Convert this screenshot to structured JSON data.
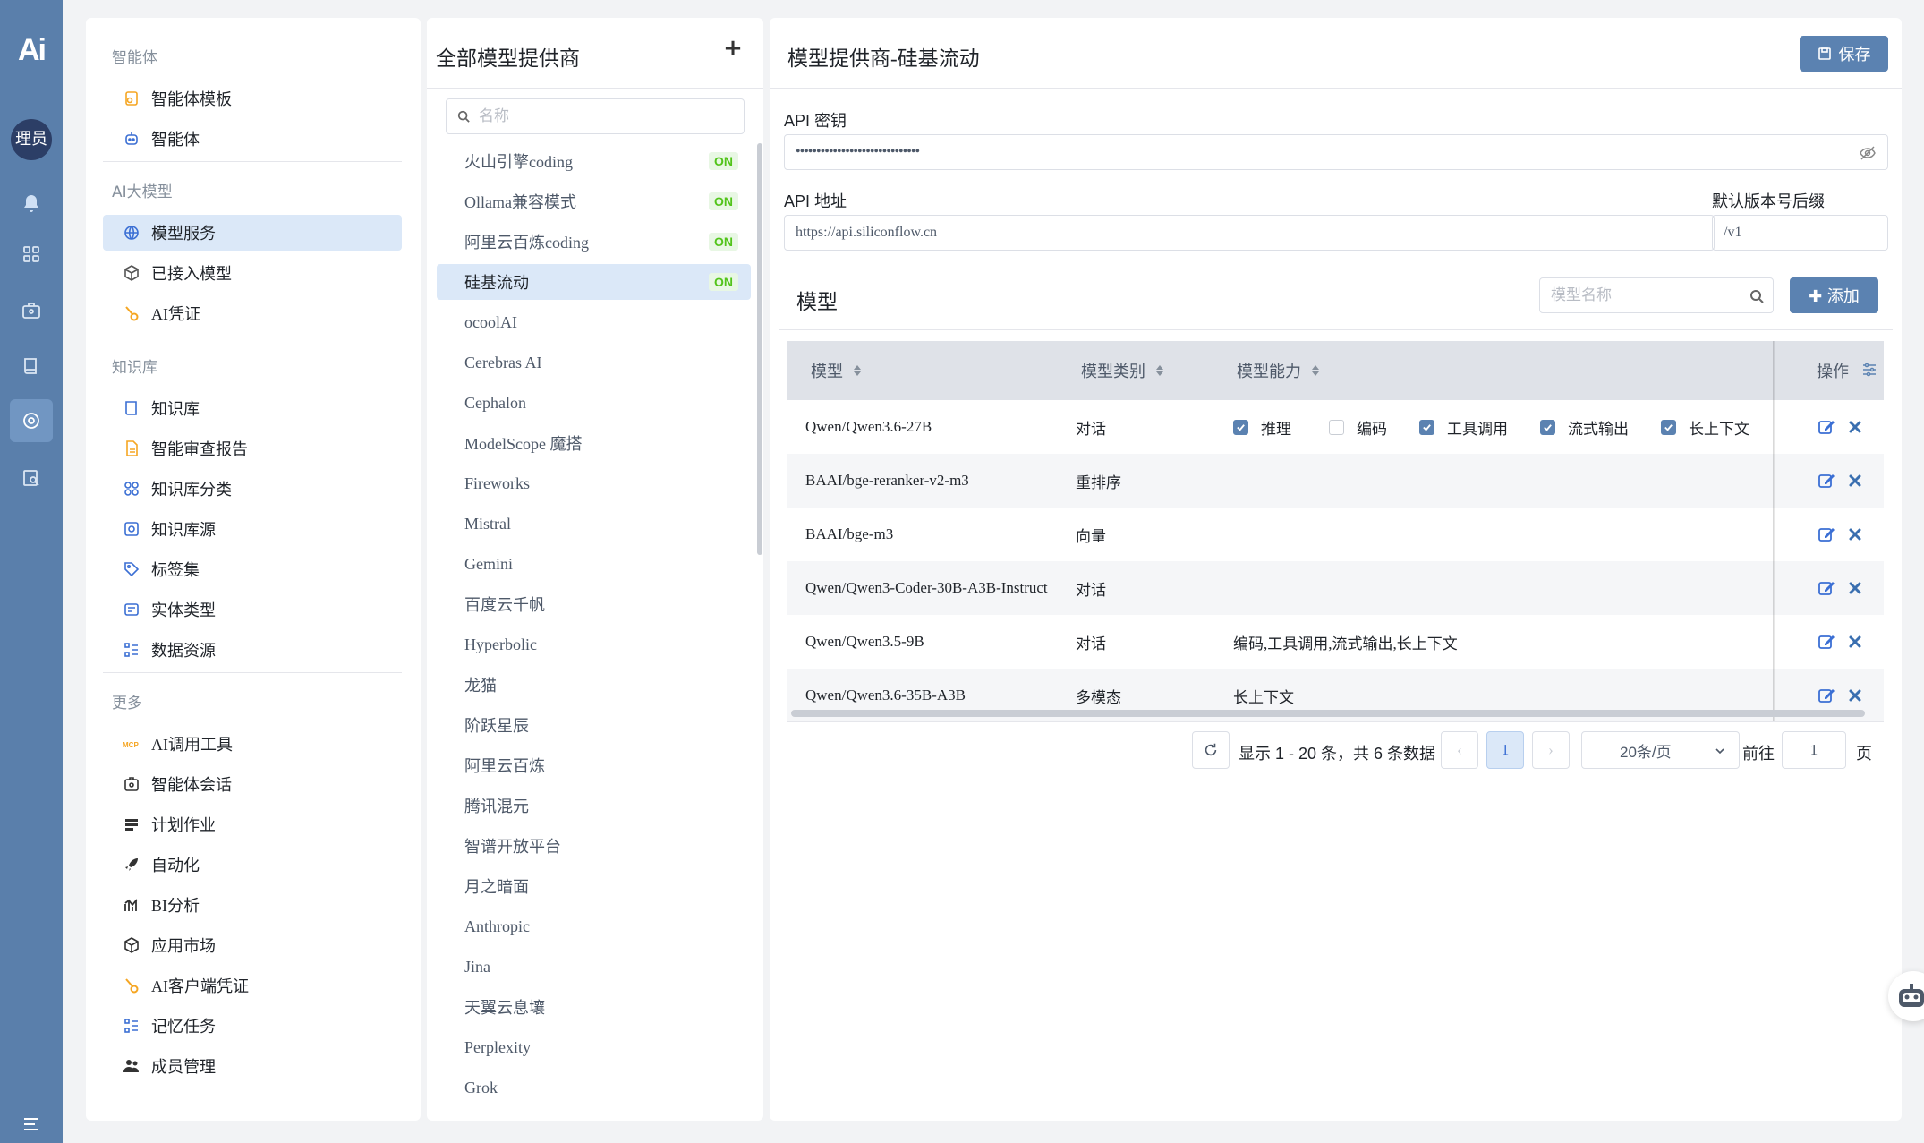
{
  "rail": {
    "logo": "Ai",
    "avatar": "理员",
    "icons": [
      "bell-icon",
      "grid-icon",
      "briefcase-icon",
      "book-icon",
      "model-icon",
      "search-doc-icon",
      "menu-icon"
    ]
  },
  "menu": {
    "groups": [
      {
        "label": "智能体",
        "items": [
          {
            "label": "智能体模板",
            "icon": "template-icon",
            "color": "#f5a623"
          },
          {
            "label": "智能体",
            "icon": "robot-icon",
            "color": "#3b6fd4"
          }
        ]
      },
      {
        "label": "AI大模型",
        "items": [
          {
            "label": "模型服务",
            "icon": "globe-icon",
            "color": "#3b6fd4",
            "active": true
          },
          {
            "label": "已接入模型",
            "icon": "cube-icon",
            "color": "#555"
          },
          {
            "label": "AI凭证",
            "icon": "key-icon",
            "color": "#f5a623"
          }
        ]
      },
      {
        "label": "知识库",
        "items": [
          {
            "label": "知识库",
            "icon": "book-icon",
            "color": "#3b6fd4"
          },
          {
            "label": "智能审查报告",
            "icon": "report-icon",
            "color": "#f5a623"
          },
          {
            "label": "知识库分类",
            "icon": "category-icon",
            "color": "#3b6fd4"
          },
          {
            "label": "知识库源",
            "icon": "source-icon",
            "color": "#3b6fd4"
          },
          {
            "label": "标签集",
            "icon": "tag-icon",
            "color": "#3b6fd4"
          },
          {
            "label": "实体类型",
            "icon": "entity-icon",
            "color": "#3b6fd4"
          },
          {
            "label": "数据资源",
            "icon": "list-icon",
            "color": "#3b6fd4"
          }
        ]
      },
      {
        "label": "更多",
        "items": [
          {
            "label": "AI调用工具",
            "icon": "mcp-icon",
            "color": "#f5a623"
          },
          {
            "label": "智能体会话",
            "icon": "chat-robot-icon",
            "color": "#333"
          },
          {
            "label": "计划作业",
            "icon": "schedule-icon",
            "color": "#333"
          },
          {
            "label": "自动化",
            "icon": "rocket-icon",
            "color": "#333"
          },
          {
            "label": "BI分析",
            "icon": "chart-icon",
            "color": "#333"
          },
          {
            "label": "应用市场",
            "icon": "box-icon",
            "color": "#333"
          },
          {
            "label": "AI客户端凭证",
            "icon": "key-icon",
            "color": "#f5a623"
          },
          {
            "label": "记忆任务",
            "icon": "list-icon",
            "color": "#3b6fd4"
          },
          {
            "label": "成员管理",
            "icon": "users-icon",
            "color": "#333"
          }
        ]
      }
    ]
  },
  "providers": {
    "title": "全部模型提供商",
    "add": "+",
    "search_placeholder": "名称",
    "on_label": "ON",
    "items": [
      {
        "name": "火山引擎coding",
        "on": true
      },
      {
        "name": "Ollama兼容模式",
        "on": true
      },
      {
        "name": "阿里云百炼coding",
        "on": true
      },
      {
        "name": "硅基流动",
        "on": true,
        "active": true
      },
      {
        "name": "ocoolAI"
      },
      {
        "name": "Cerebras AI"
      },
      {
        "name": "Cephalon"
      },
      {
        "name": "ModelScope 魔搭"
      },
      {
        "name": "Fireworks"
      },
      {
        "name": "Mistral"
      },
      {
        "name": "Gemini"
      },
      {
        "name": "百度云千帆"
      },
      {
        "name": "Hyperbolic"
      },
      {
        "name": "龙猫"
      },
      {
        "name": "阶跃星辰"
      },
      {
        "name": "阿里云百炼"
      },
      {
        "name": "腾讯混元"
      },
      {
        "name": "智谱开放平台"
      },
      {
        "name": "月之暗面"
      },
      {
        "name": "Anthropic"
      },
      {
        "name": "Jina"
      },
      {
        "name": "天翼云息壤"
      },
      {
        "name": "Perplexity"
      },
      {
        "name": "Grok"
      }
    ]
  },
  "detail": {
    "title": "模型提供商-硅基流动",
    "save_label": "保存",
    "api_key_label": "API 密钥",
    "api_key_value": "••••••••••••••••••••••••••••••",
    "api_url_label": "API 地址",
    "api_url_value": "https://api.siliconflow.cn",
    "version_label": "默认版本号后缀",
    "version_value": "/v1",
    "models_title": "模型",
    "model_search_placeholder": "模型名称",
    "add_label": "✚ 添加"
  },
  "table": {
    "columns": [
      "模型",
      "模型类别",
      "模型能力",
      "操作"
    ],
    "capability_options": [
      {
        "label": "推理",
        "checked": true
      },
      {
        "label": "编码",
        "checked": false
      },
      {
        "label": "工具调用",
        "checked": true
      },
      {
        "label": "流式输出",
        "checked": true
      },
      {
        "label": "长上下文",
        "checked": true
      }
    ],
    "rows": [
      {
        "model": "Qwen/Qwen3.6-27B",
        "type": "对话",
        "capabilities": "",
        "editing": true
      },
      {
        "model": "BAAI/bge-reranker-v2-m3",
        "type": "重排序",
        "capabilities": ""
      },
      {
        "model": "BAAI/bge-m3",
        "type": "向量",
        "capabilities": ""
      },
      {
        "model": "Qwen/Qwen3-Coder-30B-A3B-Instruct",
        "type": "对话",
        "capabilities": ""
      },
      {
        "model": "Qwen/Qwen3.5-9B",
        "type": "对话",
        "capabilities": "编码,工具调用,流式输出,长上下文"
      },
      {
        "model": "Qwen/Qwen3.6-35B-A3B",
        "type": "多模态",
        "capabilities": "长上下文"
      }
    ]
  },
  "pagination": {
    "summary": "显示 1 - 20 条，共 6 条数据",
    "current_page": "1",
    "page_size": "20条/页",
    "goto_label": "前往",
    "goto_value": "1",
    "page_suffix": "页"
  },
  "colors": {
    "accent": "#5b82b1",
    "rail": "#5a7fab",
    "active_bg": "#dbe8f8",
    "on_green": "#52c41a"
  }
}
